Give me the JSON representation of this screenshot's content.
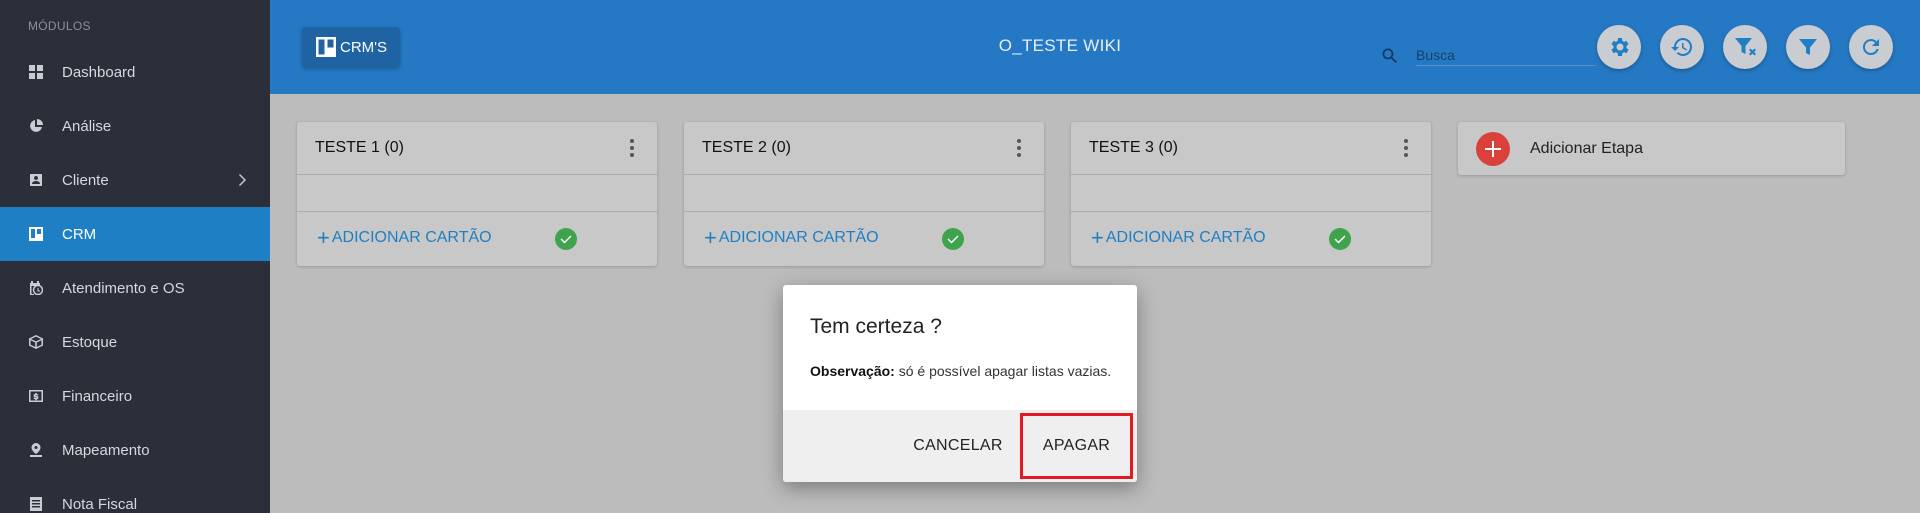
{
  "sidebar": {
    "header": "MÓDULOS",
    "items": [
      {
        "label": "Dashboard",
        "icon": "dashboard-icon"
      },
      {
        "label": "Análise",
        "icon": "pie-chart-icon"
      },
      {
        "label": "Cliente",
        "icon": "contact-card-icon"
      },
      {
        "label": "CRM",
        "icon": "trello-board-icon"
      },
      {
        "label": "Atendimento e OS",
        "icon": "calendar-clock-icon"
      },
      {
        "label": "Estoque",
        "icon": "box-icon"
      },
      {
        "label": "Financeiro",
        "icon": "money-icon"
      },
      {
        "label": "Mapeamento",
        "icon": "map-pin-icon"
      },
      {
        "label": "Nota Fiscal",
        "icon": "document-icon"
      }
    ]
  },
  "header": {
    "crm_button_label": "CRM'S",
    "title": "O_TESTE WIKI",
    "search_placeholder": "Busca",
    "icons": [
      "settings-icon",
      "history-icon",
      "clear-filter-icon",
      "filter-icon",
      "refresh-icon"
    ]
  },
  "columns": [
    {
      "title": "TESTE 1",
      "count": "(0)",
      "add_label": "ADICIONAR CARTÃO"
    },
    {
      "title": "TESTE 2",
      "count": "(0)",
      "add_label": "ADICIONAR CARTÃO"
    },
    {
      "title": "TESTE 3",
      "count": "(0)",
      "add_label": "ADICIONAR CARTÃO"
    }
  ],
  "add_stage_label": "Adicionar Etapa",
  "dialog": {
    "title": "Tem certeza ?",
    "note_label": "Observação:",
    "note_text": " só é possível apagar listas vazias.",
    "cancel_label": "CANCELAR",
    "confirm_label": "APAGAR"
  },
  "colors": {
    "primary": "#1e7fc4",
    "header": "#2579c4",
    "sidebar": "#2a2f3a",
    "danger": "#d9413a",
    "success": "#3fa34d",
    "highlight": "#e01b24"
  }
}
